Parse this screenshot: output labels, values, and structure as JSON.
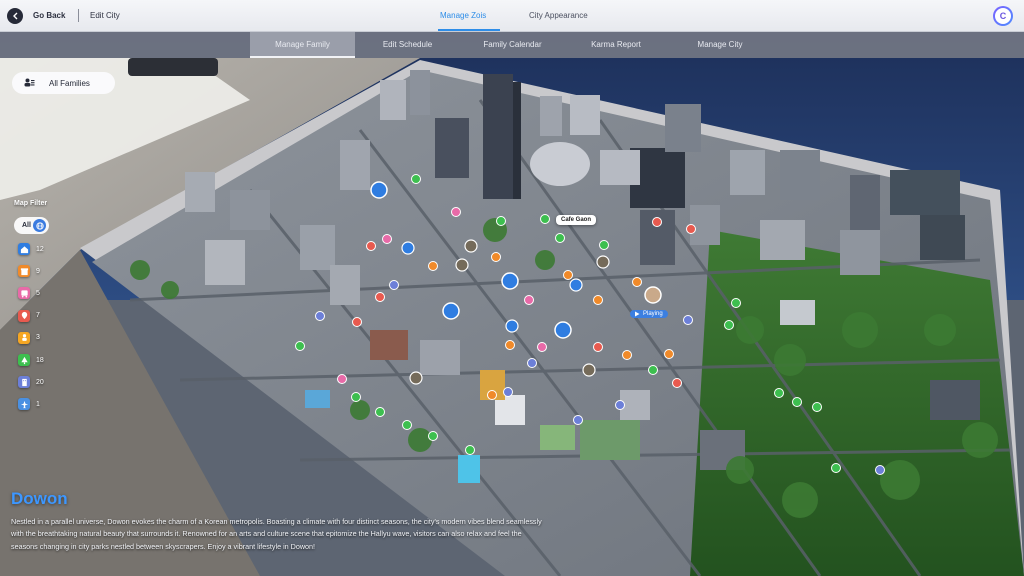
{
  "topbar": {
    "back_label": "Go Back",
    "edit_city_label": "Edit City",
    "tabs": [
      {
        "label": "Manage Zois",
        "active": true
      },
      {
        "label": "City Appearance",
        "active": false
      }
    ],
    "profile_initial": "C"
  },
  "subtabs": [
    {
      "label": "Manage Family",
      "active": true
    },
    {
      "label": "Edit Schedule",
      "active": false
    },
    {
      "label": "Family Calendar",
      "active": false
    },
    {
      "label": "Karma Report",
      "active": false
    },
    {
      "label": "Manage City",
      "active": false
    }
  ],
  "family_selector": {
    "label": "All Families"
  },
  "map_filter": {
    "title": "Map Filter",
    "all_label": "All",
    "items": [
      {
        "icon": "home-icon",
        "color": "#2f7de1",
        "count": "12"
      },
      {
        "icon": "shop-icon",
        "color": "#f08a2a",
        "count": "9"
      },
      {
        "icon": "bus-icon",
        "color": "#e86aa8",
        "count": "5"
      },
      {
        "icon": "pin-icon",
        "color": "#e85a4f",
        "count": "7"
      },
      {
        "icon": "person-icon",
        "color": "#f5a623",
        "count": "3"
      },
      {
        "icon": "tree-icon",
        "color": "#3dbf4f",
        "count": "18"
      },
      {
        "icon": "building-icon",
        "color": "#6c7fd8",
        "count": "20"
      },
      {
        "icon": "plane-icon",
        "color": "#4a90e2",
        "count": "1"
      }
    ]
  },
  "map": {
    "place_label": "Cafe Gaon",
    "status_label": "Playing"
  },
  "city": {
    "name": "Dowon",
    "description": "Nestled in a parallel universe, Dowon evokes the charm of a Korean metropolis. Boasting a climate with four distinct seasons, the city's modern vibes blend seamlessly with the breathtaking natural beauty that surrounds it. Renowned for an arts and culture scene that epitomize the Hallyu wave, visitors can also relax and feel the seasons changing in city parks nestled between skyscrapers. Enjoy a vibrant lifestyle in Dowon!"
  }
}
